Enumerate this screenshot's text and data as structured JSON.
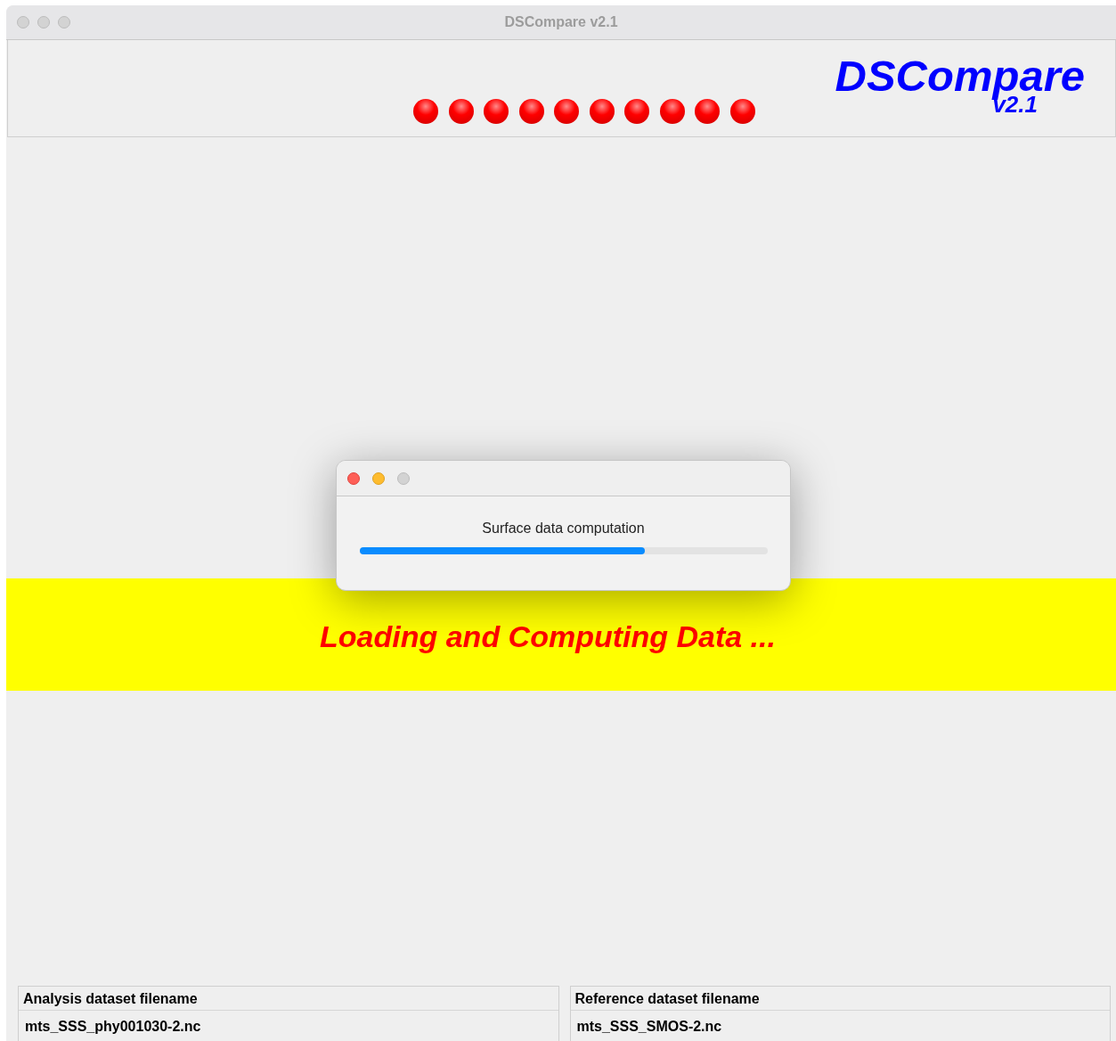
{
  "window": {
    "title": "DSCompare v2.1"
  },
  "header": {
    "logo": "DSCompare",
    "version": "v2.1"
  },
  "banner": {
    "text": "Loading and Computing Data ..."
  },
  "progress_dialog": {
    "message": "Surface data computation",
    "level": 0.7
  },
  "files": [
    {
      "label": "Analysis dataset filename",
      "value": "mts_SSS_phy001030-2.nc"
    },
    {
      "label": "Reference dataset filename",
      "value": "mts_SSS_SMOS-2.nc"
    }
  ]
}
